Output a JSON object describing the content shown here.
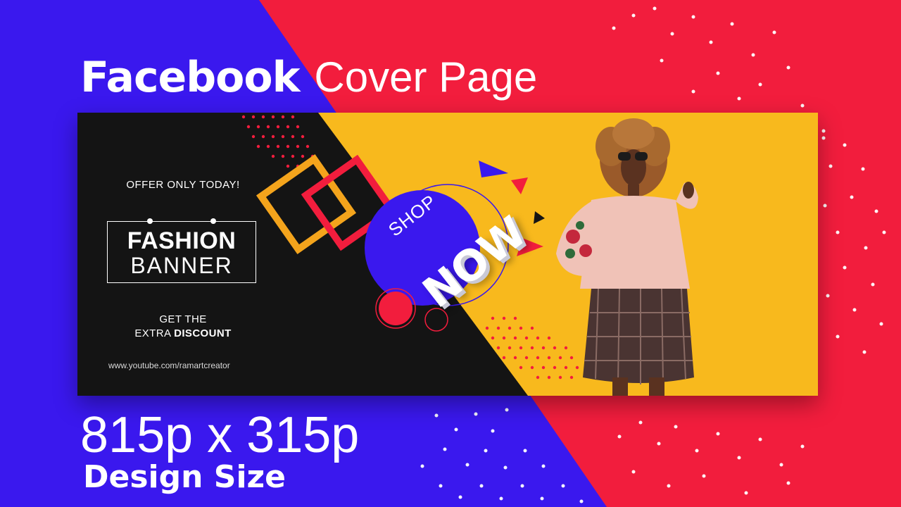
{
  "heading": {
    "bold": "Facebook",
    "light": "Cover Page"
  },
  "size_line": "815p x 315p",
  "size_caption": "Design Size",
  "banner": {
    "offer": "OFFER ONLY TODAY!",
    "title_line1": "FASHION",
    "title_line2": "BANNER",
    "discount_line1": "GET THE",
    "discount_prefix": "EXTRA",
    "discount_bold": "DISCOUNT",
    "url": "www.youtube.com/ramartcreator",
    "shop": "SHOP",
    "now": "NOW"
  },
  "colors": {
    "blue": "#3a18ee",
    "red": "#f21d3d",
    "yellow": "#f8b91d",
    "black": "#141414",
    "orange": "#f4a41c",
    "white": "#ffffff"
  },
  "photo": {
    "icon": "model-photo-illustration"
  }
}
